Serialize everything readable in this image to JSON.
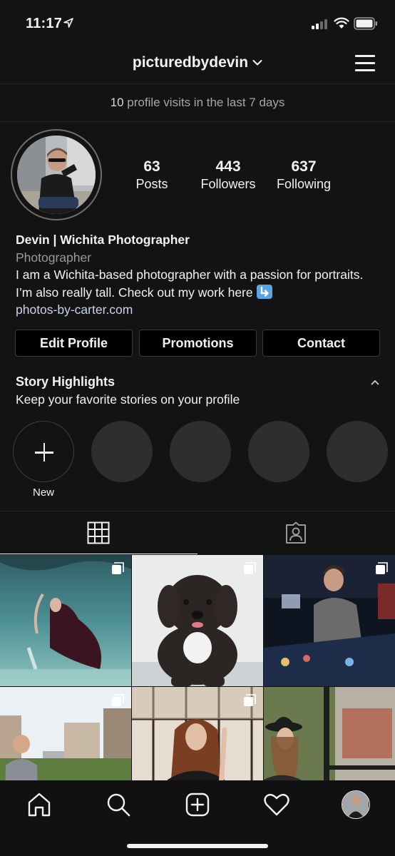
{
  "status_bar": {
    "time": "11:17"
  },
  "header": {
    "username": "picturedbydevin"
  },
  "insights": {
    "count": "10",
    "text": " profile visits in the last 7 days"
  },
  "stats": [
    {
      "number": "63",
      "label": "Posts"
    },
    {
      "number": "443",
      "label": "Followers"
    },
    {
      "number": "637",
      "label": "Following"
    }
  ],
  "bio": {
    "name": "Devin | Wichita Photographer",
    "category": "Photographer",
    "text": "I am a Wichita-based photographer with a passion for portraits. I’m also really tall. Check out my work here",
    "emoji": "arrow-down-right-emoji",
    "link": "photos-by-carter.com"
  },
  "buttons": {
    "edit": "Edit Profile",
    "promotions": "Promotions",
    "contact": "Contact"
  },
  "highlights": {
    "title": "Story Highlights",
    "subtitle": "Keep your favorite stories on your profile",
    "new_label": "New"
  },
  "tabs": [
    "grid-icon",
    "tagged-icon"
  ],
  "posts": [
    {
      "subject": "underwater dress",
      "multi": true
    },
    {
      "subject": "black puppy",
      "multi": true
    },
    {
      "subject": "pinball arcade",
      "multi": true
    },
    {
      "subject": "city skyline portrait",
      "multi": true
    },
    {
      "subject": "window portrait",
      "multi": true
    },
    {
      "subject": "hat portrait",
      "multi": false
    }
  ],
  "nav": [
    "home-icon",
    "search-icon",
    "new-post-icon",
    "activity-heart-icon",
    "profile-avatar"
  ],
  "colors": {
    "background": "#131313",
    "button_bg": "#000000",
    "link": "#c8d3ea",
    "muted": "#9a9a9a"
  }
}
